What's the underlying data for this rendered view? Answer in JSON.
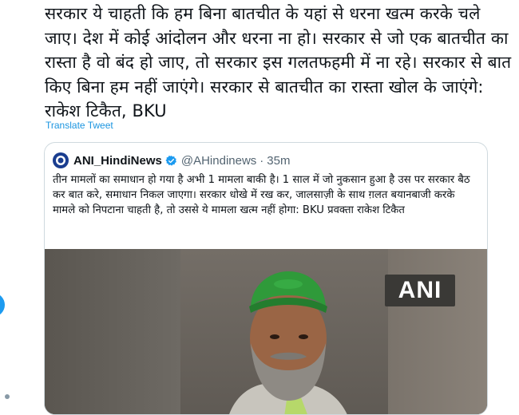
{
  "tweet": {
    "text": "सरकार ये चाहती कि हम बिना बातचीत के यहां से धरना खत्म करके चले जाए। देश में कोई आंदोलन और धरना ना हो। सरकार से जो एक बातचीत का रास्ता है वो बंद हो जाए, तो सरकार इस गलतफहमी में ना रहे। सरकार से बात किए बिना हम नहीं जाएंगे। सरकार से बातचीत का रास्ता खोल के जाएंगे: राकेश टिकैत, BKU",
    "translate_label": "Translate Tweet"
  },
  "quoted_tweet": {
    "display_name": "ANI_HindiNews",
    "handle": "@AHindinews",
    "separator": "·",
    "time": "35m",
    "text": "तीन मामलों का समाधान हो गया है अभी 1 मामला बाकी है। 1 साल में जो नुकसान हुआ है उस पर सरकार बैठ कर बात करे, समाधान निकल जाएगा। सरकार धोखे में रख कर, जालसाज़ी के साथ ग़लत बयानबाजी करके मामले को निपटाना चाहती है, तो उससे ये मामला खत्म नहीं होगा: BKU प्रवक्ता राकेश टिकैत",
    "media_watermark": "ANI"
  },
  "colors": {
    "link": "#1b95e0",
    "verified": "#1d9bf0",
    "border": "#cfd9de",
    "cap_green": "#2f9a3a"
  }
}
